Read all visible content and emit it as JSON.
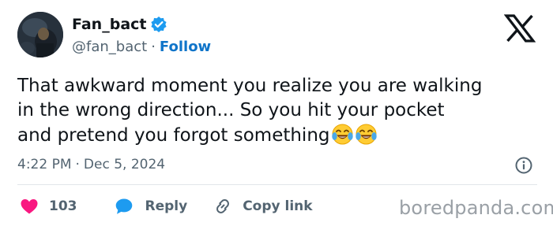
{
  "author": {
    "display_name": "Fan_bact",
    "handle": "@fan_bact",
    "separator": "·",
    "follow_label": "Follow",
    "verified_icon": "verified-badge-icon"
  },
  "platform_logo": "x-logo-icon",
  "tweet": {
    "lines": [
      "That awkward moment you realize you are walking",
      "in the wrong direction... So you hit your pocket",
      "and pretend you forgot something"
    ],
    "emojis": [
      "face-with-tears-of-joy",
      "face-with-tears-of-joy"
    ]
  },
  "meta": {
    "time": "4:22 PM",
    "separator": "·",
    "date": "Dec 5, 2024"
  },
  "actions": {
    "like_count": "103",
    "reply_label": "Reply",
    "copy_link_label": "Copy link"
  },
  "watermark": "boredpanda.com",
  "colors": {
    "text": "#0f1419",
    "muted": "#536471",
    "link_blue": "#0f74c9",
    "verified_blue": "#1d9bf0",
    "like_pink": "#f91880",
    "reply_blue": "#1d9bf0"
  }
}
